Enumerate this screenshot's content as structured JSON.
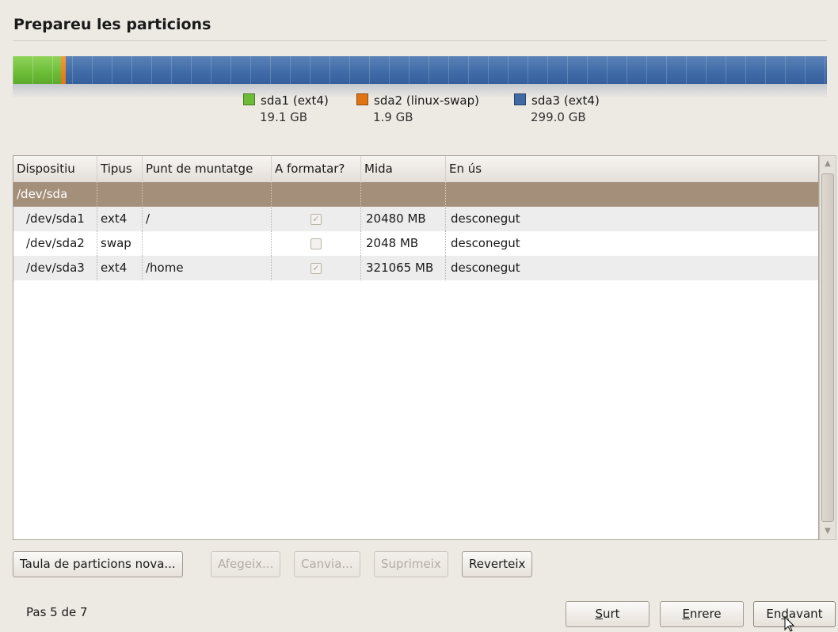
{
  "page": {
    "title": "Prepareu les particions"
  },
  "colors": {
    "sda1": "#6cbc37",
    "sda2": "#e07412",
    "sda3": "#3f6aa6",
    "disk_row": "#a38f7a"
  },
  "legend": [
    {
      "label": "sda1 (ext4)",
      "size": "19.1 GB"
    },
    {
      "label": "sda2 (linux-swap)",
      "size": "1.9 GB"
    },
    {
      "label": "sda3 (ext4)",
      "size": "299.0 GB"
    }
  ],
  "table": {
    "headers": [
      "Dispositiu",
      "Tipus",
      "Punt de muntatge",
      "A formatar?",
      "Mida",
      "En ús"
    ],
    "disk": "/dev/sda",
    "rows": [
      {
        "device": "/dev/sda1",
        "type": "ext4",
        "mount": "/",
        "format": true,
        "size": "20480 MB",
        "used": "desconegut"
      },
      {
        "device": "/dev/sda2",
        "type": "swap",
        "mount": "",
        "format": false,
        "size": "2048 MB",
        "used": "desconegut"
      },
      {
        "device": "/dev/sda3",
        "type": "ext4",
        "mount": "/home",
        "format": true,
        "size": "321065 MB",
        "used": "desconegut"
      }
    ]
  },
  "actions": {
    "new_table": "Taula de particions nova...",
    "add": "Afegeix...",
    "change": "Canvia...",
    "delete": "Suprimeix",
    "revert": "Reverteix"
  },
  "footer": {
    "step": "Pas 5 de 7",
    "quit_mn": "S",
    "quit_rest": "urt",
    "back_mn": "E",
    "back_rest": "nrere",
    "forward_pre": "En",
    "forward_mn": "d",
    "forward_rest": "avant"
  }
}
